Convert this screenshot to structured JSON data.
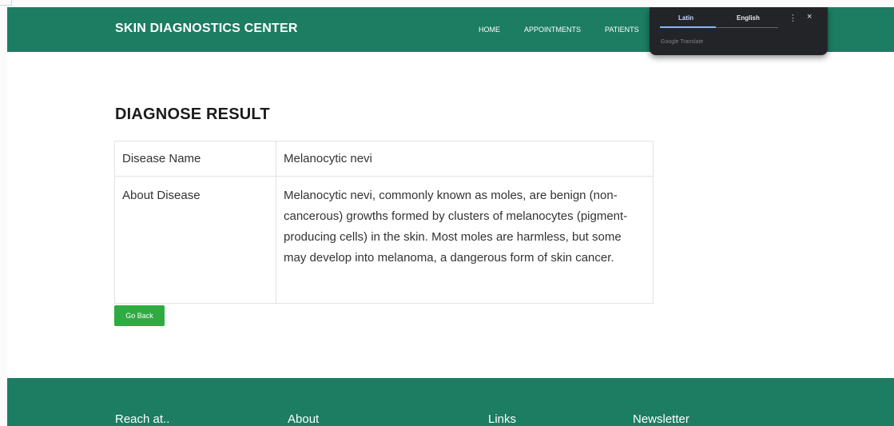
{
  "navbar": {
    "brand": "SKIN DIAGNOSTICS CENTER",
    "links": [
      "HOME",
      "APPOINTMENTS",
      "PATIENTS"
    ]
  },
  "translate_popup": {
    "source_lang": "Latin",
    "target_lang": "English",
    "caption": "Google Translate",
    "more_icon": "⋮",
    "close_icon": "×"
  },
  "main": {
    "title": "DIAGNOSE RESULT",
    "rows": [
      {
        "label": "Disease Name",
        "value": "Melanocytic nevi"
      },
      {
        "label": "About Disease",
        "value": "Melanocytic nevi, commonly known as moles, are benign (non-cancerous) growths formed by clusters of melanocytes (pigment-producing cells) in the skin. Most moles are harmless, but some may develop into melanoma, a dangerous form of skin cancer."
      }
    ],
    "back_button": "Go Back"
  },
  "footer": {
    "headings": [
      "Reach at..",
      "About",
      "Links",
      "Newsletter"
    ]
  },
  "colors": {
    "primary_green": "#1c7d63",
    "button_green": "#2fab41",
    "popup_bg": "#232427"
  }
}
